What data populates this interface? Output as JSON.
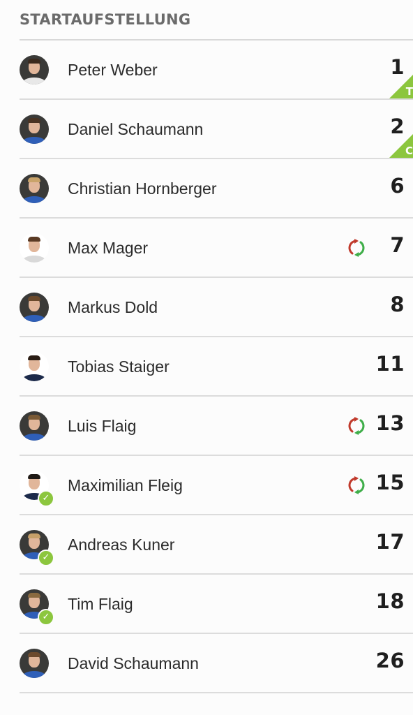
{
  "section": {
    "title": "STARTAUFSTELLUNG"
  },
  "colors": {
    "accent_green": "#8cc63e",
    "sub_red": "#c0392b",
    "sub_green": "#3fae49",
    "kit_blue": "#2f5fb8"
  },
  "players": [
    {
      "name": "Peter Weber",
      "number": "1",
      "badge": "T",
      "substitution": false,
      "confirmed": false,
      "avatar": "player-photo-dark"
    },
    {
      "name": "Daniel Schaumann",
      "number": "2",
      "badge": "C",
      "substitution": false,
      "confirmed": false,
      "avatar": "player-photo-dark"
    },
    {
      "name": "Christian Hornberger",
      "number": "6",
      "badge": "",
      "substitution": false,
      "confirmed": false,
      "avatar": "player-photo-dark"
    },
    {
      "name": "Max Mager",
      "number": "7",
      "badge": "",
      "substitution": true,
      "confirmed": false,
      "avatar": "player-photo-light"
    },
    {
      "name": "Markus Dold",
      "number": "8",
      "badge": "",
      "substitution": false,
      "confirmed": false,
      "avatar": "player-photo-dark"
    },
    {
      "name": "Tobias Staiger",
      "number": "11",
      "badge": "",
      "substitution": false,
      "confirmed": false,
      "avatar": "player-photo-light"
    },
    {
      "name": "Luis Flaig",
      "number": "13",
      "badge": "",
      "substitution": true,
      "confirmed": false,
      "avatar": "player-photo-dark"
    },
    {
      "name": "Maximilian Fleig",
      "number": "15",
      "badge": "",
      "substitution": true,
      "confirmed": true,
      "avatar": "player-photo-light"
    },
    {
      "name": "Andreas Kuner",
      "number": "17",
      "badge": "",
      "substitution": false,
      "confirmed": true,
      "avatar": "player-photo-dark"
    },
    {
      "name": "Tim Flaig",
      "number": "18",
      "badge": "",
      "substitution": false,
      "confirmed": true,
      "avatar": "player-photo-dark"
    },
    {
      "name": "David Schaumann",
      "number": "26",
      "badge": "",
      "substitution": false,
      "confirmed": false,
      "avatar": "player-photo-dark"
    }
  ]
}
